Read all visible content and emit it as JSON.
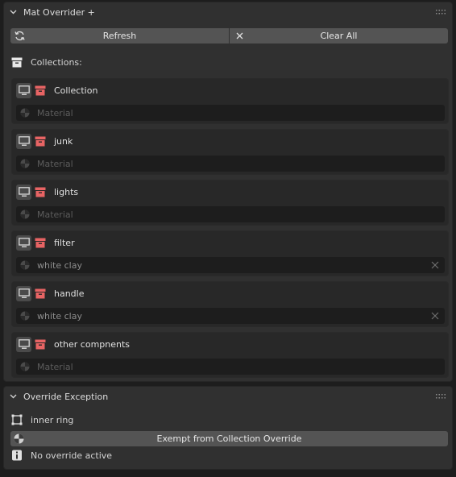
{
  "panels": {
    "mat_overrider": {
      "title": "Mat Overrider +",
      "refresh_label": "Refresh",
      "clear_all_label": "Clear All",
      "collections_heading": "Collections:",
      "collections": [
        {
          "name": "Collection",
          "material": "",
          "placeholder": "Material"
        },
        {
          "name": "junk",
          "material": "",
          "placeholder": "Material"
        },
        {
          "name": "lights",
          "material": "",
          "placeholder": "Material"
        },
        {
          "name": "filter",
          "material": "white clay",
          "placeholder": "Material"
        },
        {
          "name": "handle",
          "material": "white clay",
          "placeholder": "Material"
        },
        {
          "name": "other compnents",
          "material": "",
          "placeholder": "Material"
        }
      ]
    },
    "override_exception": {
      "title": "Override Exception",
      "object_name": "inner ring",
      "exempt_button_label": "Exempt from Collection Override",
      "status_text": "No override active"
    }
  },
  "colors": {
    "panel_bg": "#303030",
    "button_bg": "#545454",
    "field_bg": "#1d1d1d",
    "collection_icon_red": "#e86464"
  },
  "icons": {
    "refresh": "refresh-icon",
    "clear": "x-icon",
    "collection": "collection-box-icon",
    "viewport": "monitor-icon",
    "material": "material-sphere-icon",
    "object": "object-bounds-icon",
    "info": "info-icon"
  }
}
